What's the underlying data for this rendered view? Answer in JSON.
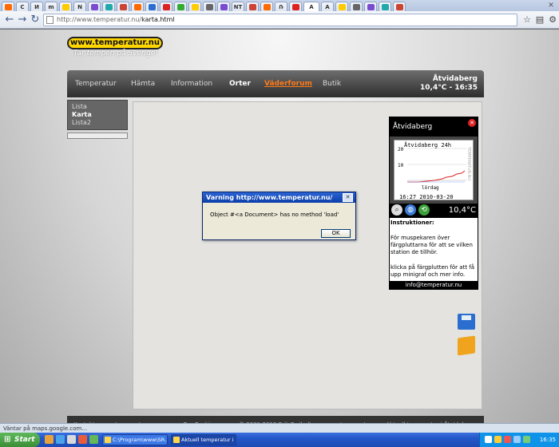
{
  "browser": {
    "tab_letters": [
      "",
      "C",
      "И",
      "m",
      "",
      "N",
      "",
      "",
      "",
      "",
      "",
      "",
      "",
      "",
      "",
      "",
      "NT",
      "",
      "",
      "Ռ",
      "",
      "A",
      "",
      "",
      "",
      "",
      ""
    ],
    "active_tab_letter": "A",
    "url_host": "http://www.temperatur.nu/",
    "url_path": "karta.html"
  },
  "site": {
    "logo_text": "www.temperatur.nu",
    "tagline": "Tar tempen på Sverige!",
    "nav": {
      "temperatur": "Temperatur",
      "hamta": "Hämta",
      "information": "Information",
      "orter": "Orter",
      "vaderforum": "Väderforum",
      "butik": "Butik"
    },
    "location_name": "Åtvidaberg",
    "location_reading": "10,4°C - 16:35",
    "subnav": {
      "lista": "Lista",
      "karta": "Karta",
      "lista2": "Lista2"
    }
  },
  "widget": {
    "title": "Åtvidaberg",
    "graph_title": "Åtvidaberg 24h",
    "graph_side": "TEMPERATUR.NU",
    "y_labels": [
      "20",
      "10"
    ],
    "day_label": "lördag",
    "footer_time": "16:27 2010-03-20",
    "temp": "10,4°C",
    "instructions_heading": "Instruktioner:",
    "instructions_1": "För muspekaren över färgpluttarna för att se vilken station de tillhör.",
    "instructions_2": "klicka på färgplutten för att få upp minigraf och mer info.",
    "email": "info@temperatur.nu"
  },
  "footer": {
    "contact": "Kontakta www.temperatur.nu",
    "about": "Om Cookies",
    "copyright": "© 2001-2010 Erik Freiholtz",
    "tagline": "temperatur.nu - Aktuell temperatur i Åtvidaberg"
  },
  "dialog": {
    "title": "Varning http://www.temperatur.nu/",
    "message": "Object #<a Document> has no method 'load'",
    "ok_label": "OK"
  },
  "status": {
    "text": "Väntar på maps.google.com..."
  },
  "taskbar": {
    "start_label": "Start",
    "task_1": "C:\\Program\\www\\SR...",
    "task_2": "Aktuell temperatur i S...",
    "clock": "16:35"
  },
  "colors": {
    "logo_yellow": "#ffd700",
    "nav_highlight": "#ff7a1a",
    "dialog_title": "#0b3ea8"
  }
}
